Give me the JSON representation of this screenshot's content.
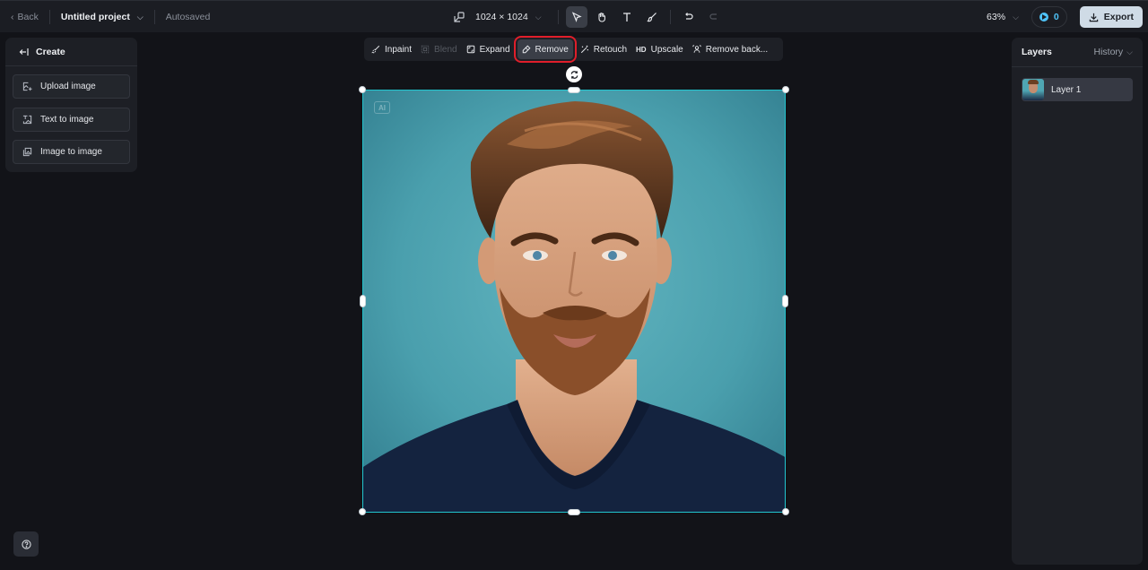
{
  "topbar": {
    "back_label": "Back",
    "project_name": "Untitled project",
    "save_status": "Autosaved",
    "canvas_size": "1024 × 1024",
    "zoom_level": "63%",
    "credits": "0",
    "export_label": "Export",
    "tools": [
      {
        "name": "select",
        "icon": "cursor-icon",
        "active": true
      },
      {
        "name": "hand",
        "icon": "hand-icon",
        "active": false
      },
      {
        "name": "text",
        "icon": "text-icon",
        "active": false
      },
      {
        "name": "brush",
        "icon": "brush-icon",
        "active": false
      },
      {
        "name": "undo",
        "icon": "undo-icon",
        "active": false
      },
      {
        "name": "redo",
        "icon": "redo-icon",
        "disabled": true
      }
    ]
  },
  "create_panel": {
    "title": "Create",
    "items": [
      {
        "label": "Upload image",
        "icon": "upload-image-icon"
      },
      {
        "label": "Text to image",
        "icon": "text-to-image-icon"
      },
      {
        "label": "Image to image",
        "icon": "image-to-image-icon"
      }
    ]
  },
  "edit_toolbar": {
    "items": [
      {
        "label": "Inpaint",
        "icon": "inpaint-icon",
        "state": "normal"
      },
      {
        "label": "Blend",
        "icon": "blend-icon",
        "state": "disabled"
      },
      {
        "label": "Expand",
        "icon": "expand-icon",
        "state": "normal"
      },
      {
        "label": "Remove",
        "icon": "eraser-icon",
        "state": "selected"
      },
      {
        "label": "Retouch",
        "icon": "retouch-icon",
        "state": "normal"
      },
      {
        "label": "Upscale",
        "icon": "hd-icon",
        "icon_text": "HD",
        "state": "normal"
      },
      {
        "label": "Remove back...",
        "icon": "remove-background-icon",
        "state": "normal"
      }
    ]
  },
  "canvas": {
    "ai_badge": "AI",
    "image_description": "Portrait of a bearded man with styled brown hair in a navy t-shirt on a teal background",
    "selection_color": "#22c6cf"
  },
  "layers_panel": {
    "title": "Layers",
    "history_label": "History",
    "layers": [
      {
        "name": "Layer 1"
      }
    ]
  },
  "colors": {
    "accent_cyan": "#22c6cf",
    "highlight_red": "#e01e2a",
    "credits_blue": "#4fc3f7",
    "export_bg": "#cfdbe6"
  }
}
